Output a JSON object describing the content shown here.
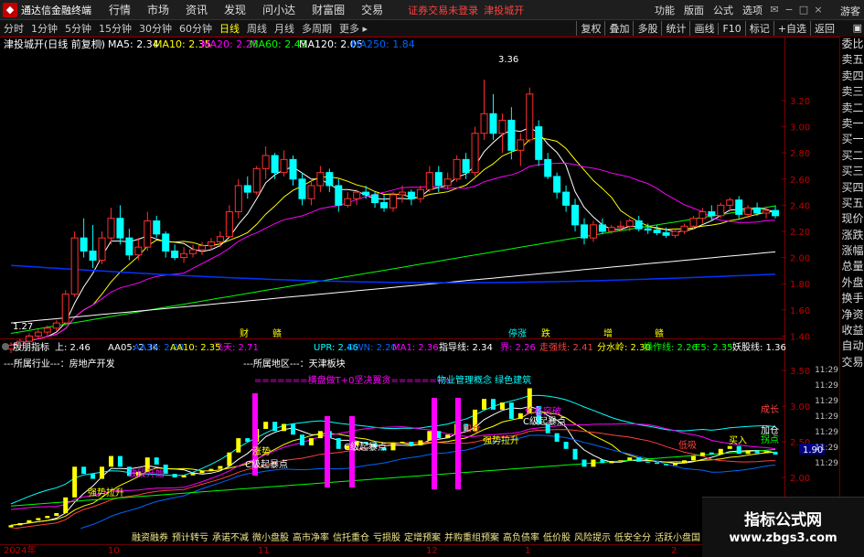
{
  "titlebar": {
    "app_name": "通达信金融终端",
    "menus": [
      "行情",
      "市场",
      "资讯",
      "发现",
      "问小达",
      "财富圈",
      "交易"
    ],
    "notice": "证券交易未登录",
    "stock": "津投城开",
    "right_menus": [
      "功能",
      "版面",
      "公式",
      "选项"
    ],
    "guest": "游客"
  },
  "tabs": [
    "分时",
    "1分钟",
    "5分钟",
    "15分钟",
    "30分钟",
    "60分钟",
    "日线",
    "周线",
    "月线",
    "多周期",
    "更多 ▸"
  ],
  "active_tab": "日线",
  "tools": [
    "复权",
    "叠加",
    "多股",
    "统计",
    "画线",
    "F10",
    "标记",
    "+自选",
    "返回"
  ],
  "sidebar": [
    "委比",
    "卖五",
    "卖四",
    "卖三",
    "卖二",
    "卖一",
    "买一",
    "买二",
    "买三",
    "买四",
    "买五",
    "现价",
    "涨跌",
    "涨幅",
    "总量",
    "外盘",
    "换手",
    "净资",
    "收益",
    "自动",
    "交易"
  ],
  "main_chart": {
    "title": "津投城开(日线 前复权)",
    "ma_labels": [
      {
        "text": "MA5: 2.34",
        "color": "#ffffff"
      },
      {
        "text": "MA10: 2.35",
        "color": "#ffff00"
      },
      {
        "text": "MA20: 2.28",
        "color": "#ff00ff"
      },
      {
        "text": "MA60: 2.43",
        "color": "#00ff00"
      },
      {
        "text": "MA120: 2.05",
        "color": "#ffffff"
      },
      {
        "text": "MA250: 1.84",
        "color": "#0066ff"
      }
    ],
    "y_ticks": [
      "3.20",
      "3.00",
      "2.80",
      "2.60",
      "2.40",
      "2.20",
      "2.00",
      "1.80",
      "1.60",
      "1.40"
    ],
    "high_label": "3.36",
    "low_label": "1.27",
    "event_markers": [
      "财",
      "赣",
      "停涨",
      "跌",
      "增",
      "赣"
    ],
    "candles": [
      [
        1.3,
        1.35,
        1.27,
        1.33
      ],
      [
        1.33,
        1.38,
        1.3,
        1.36
      ],
      [
        1.36,
        1.42,
        1.34,
        1.4
      ],
      [
        1.4,
        1.45,
        1.38,
        1.43
      ],
      [
        1.43,
        1.48,
        1.4,
        1.46
      ],
      [
        1.46,
        1.52,
        1.44,
        1.5
      ],
      [
        1.5,
        1.75,
        1.48,
        1.72
      ],
      [
        1.72,
        2.2,
        1.7,
        2.15
      ],
      [
        2.15,
        2.3,
        2.0,
        2.05
      ],
      [
        2.05,
        2.25,
        1.92,
        1.98
      ],
      [
        1.98,
        2.2,
        1.95,
        2.15
      ],
      [
        2.15,
        2.38,
        2.1,
        2.3
      ],
      [
        2.3,
        2.4,
        2.1,
        2.15
      ],
      [
        2.15,
        2.22,
        1.98,
        2.02
      ],
      [
        2.02,
        2.15,
        1.98,
        2.08
      ],
      [
        2.08,
        2.35,
        2.05,
        2.28
      ],
      [
        2.28,
        2.32,
        2.15,
        2.18
      ],
      [
        2.18,
        2.2,
        2.0,
        2.05
      ],
      [
        2.05,
        2.1,
        1.98,
        2.0
      ],
      [
        2.0,
        2.08,
        1.96,
        2.03
      ],
      [
        2.03,
        2.1,
        2.0,
        2.06
      ],
      [
        2.06,
        2.12,
        2.02,
        2.09
      ],
      [
        2.09,
        2.15,
        2.06,
        2.12
      ],
      [
        2.12,
        2.2,
        2.08,
        2.16
      ],
      [
        2.16,
        2.4,
        2.15,
        2.35
      ],
      [
        2.35,
        2.6,
        2.3,
        2.55
      ],
      [
        2.55,
        2.62,
        2.45,
        2.5
      ],
      [
        2.5,
        2.7,
        2.48,
        2.68
      ],
      [
        2.68,
        2.85,
        2.6,
        2.78
      ],
      [
        2.78,
        2.8,
        2.6,
        2.65
      ],
      [
        2.65,
        2.82,
        2.62,
        2.75
      ],
      [
        2.75,
        2.78,
        2.55,
        2.6
      ],
      [
        2.6,
        2.65,
        2.4,
        2.45
      ],
      [
        2.45,
        2.6,
        2.4,
        2.55
      ],
      [
        2.55,
        2.7,
        2.5,
        2.65
      ],
      [
        2.65,
        2.68,
        2.5,
        2.55
      ],
      [
        2.55,
        2.6,
        2.35,
        2.4
      ],
      [
        2.4,
        2.5,
        2.38,
        2.45
      ],
      [
        2.45,
        2.52,
        2.4,
        2.5
      ],
      [
        2.5,
        2.55,
        2.45,
        2.48
      ],
      [
        2.48,
        2.5,
        2.38,
        2.42
      ],
      [
        2.42,
        2.48,
        2.35,
        2.38
      ],
      [
        2.38,
        2.5,
        2.35,
        2.48
      ],
      [
        2.48,
        2.55,
        2.42,
        2.5
      ],
      [
        2.5,
        2.52,
        2.4,
        2.45
      ],
      [
        2.45,
        2.55,
        2.42,
        2.52
      ],
      [
        2.52,
        2.7,
        2.5,
        2.65
      ],
      [
        2.65,
        2.7,
        2.5,
        2.55
      ],
      [
        2.55,
        2.65,
        2.52,
        2.6
      ],
      [
        2.6,
        2.78,
        2.58,
        2.75
      ],
      [
        2.75,
        2.8,
        2.6,
        2.65
      ],
      [
        2.65,
        3.0,
        2.62,
        2.95
      ],
      [
        2.95,
        3.36,
        2.9,
        3.1
      ],
      [
        3.1,
        3.25,
        2.9,
        2.95
      ],
      [
        2.95,
        3.1,
        2.8,
        3.05
      ],
      [
        3.05,
        3.15,
        2.75,
        2.82
      ],
      [
        2.82,
        2.95,
        2.7,
        2.9
      ],
      [
        2.9,
        3.3,
        2.88,
        3.25
      ],
      [
        3.0,
        3.05,
        2.7,
        2.75
      ],
      [
        2.75,
        2.8,
        2.6,
        2.62
      ],
      [
        2.62,
        2.65,
        2.45,
        2.5
      ],
      [
        2.5,
        2.55,
        2.35,
        2.4
      ],
      [
        2.4,
        2.45,
        2.2,
        2.25
      ],
      [
        2.25,
        2.3,
        2.1,
        2.15
      ],
      [
        2.15,
        2.28,
        2.12,
        2.25
      ],
      [
        2.25,
        2.3,
        2.18,
        2.2
      ],
      [
        2.2,
        2.25,
        2.18,
        2.23
      ],
      [
        2.23,
        2.28,
        2.2,
        2.24
      ],
      [
        2.24,
        2.3,
        2.2,
        2.28
      ],
      [
        2.28,
        2.32,
        2.2,
        2.22
      ],
      [
        2.22,
        2.26,
        2.18,
        2.21
      ],
      [
        2.21,
        2.25,
        2.17,
        2.19
      ],
      [
        2.19,
        2.23,
        2.15,
        2.17
      ],
      [
        2.17,
        2.22,
        2.15,
        2.2
      ],
      [
        2.2,
        2.26,
        2.18,
        2.24
      ],
      [
        2.24,
        2.32,
        2.22,
        2.3
      ],
      [
        2.3,
        2.38,
        2.26,
        2.35
      ],
      [
        2.35,
        2.4,
        2.28,
        2.32
      ],
      [
        2.32,
        2.42,
        2.3,
        2.4
      ],
      [
        2.4,
        2.46,
        2.35,
        2.44
      ],
      [
        2.44,
        2.47,
        2.3,
        2.33
      ],
      [
        2.33,
        2.4,
        2.3,
        2.38
      ],
      [
        2.38,
        2.42,
        2.32,
        2.34
      ],
      [
        2.34,
        2.38,
        2.3,
        2.36
      ],
      [
        2.36,
        2.4,
        2.3,
        2.32
      ]
    ]
  },
  "sub_chart": {
    "indicator_name": "殷朋指标",
    "values": [
      {
        "text": "上: 2.46",
        "color": "#ffffff"
      },
      {
        "text": "AA05: 2.34",
        "color": "#ffffff"
      },
      {
        "text": "AA30: 2.28",
        "color": "#0066ff"
      },
      {
        "text": "AA10: 2.35",
        "color": "#ffff00"
      },
      {
        "text": "飞天: 2.71",
        "color": "#ff00ff"
      },
      {
        "text": "UPR: 2.46",
        "color": "#00ffff"
      },
      {
        "text": "DWN: 2.20",
        "color": "#0066ff"
      },
      {
        "text": "MA1: 2.36",
        "color": "#ff00ff"
      },
      {
        "text": "指导线: 2.34",
        "color": "#ffffff"
      },
      {
        "text": "界: 2.26",
        "color": "#ff00ff"
      },
      {
        "text": "走强线: 2.41",
        "color": "#ff4040"
      },
      {
        "text": "分水岭: 2.30",
        "color": "#ffff00"
      },
      {
        "text": "操作线: 2.26",
        "color": "#00ff00"
      },
      {
        "text": "E5: 2.35",
        "color": "#00ff00"
      },
      {
        "text": "妖股线: 1.36",
        "color": "#ffffff"
      }
    ],
    "industry": "---所属行业---：房地产开发",
    "region": "---所属地区---：天津板块",
    "banner": "=======横盘做T+0坚决翼贪========",
    "mgmt": "物业管理概念 绿色建筑",
    "y_ticks": [
      "3.50",
      "3.00",
      "2.50",
      "2.00",
      "1.50"
    ],
    "price_box": "1.90",
    "annotations": [
      "波段开始",
      "强势拉升",
      "C级起暴点",
      "C级起暴点",
      "C级起暴点",
      "强势拉升",
      "加仓",
      "低吸",
      "买入",
      "涨势",
      "价格突破",
      "成长",
      "加仓",
      "拐点"
    ]
  },
  "bottom_bar": [
    "融资融券",
    "预计转亏",
    "承诺不减",
    "微小盘股",
    "高市净率",
    "信托重仓",
    "亏损股",
    "定增预案",
    "并购重组预案",
    "高负债率",
    "低价股",
    "风险提示",
    "低安全分",
    "活跃小盘国"
  ],
  "date_axis": [
    "2024年",
    "10",
    "11",
    "12",
    "1",
    "2"
  ],
  "time_axis": [
    "11:29",
    "11:29",
    "11:29",
    "11:29",
    "11:29",
    "11:29",
    "11:29"
  ],
  "watermark": {
    "title": "指标公式网",
    "url": "www.zbgs3.com"
  }
}
